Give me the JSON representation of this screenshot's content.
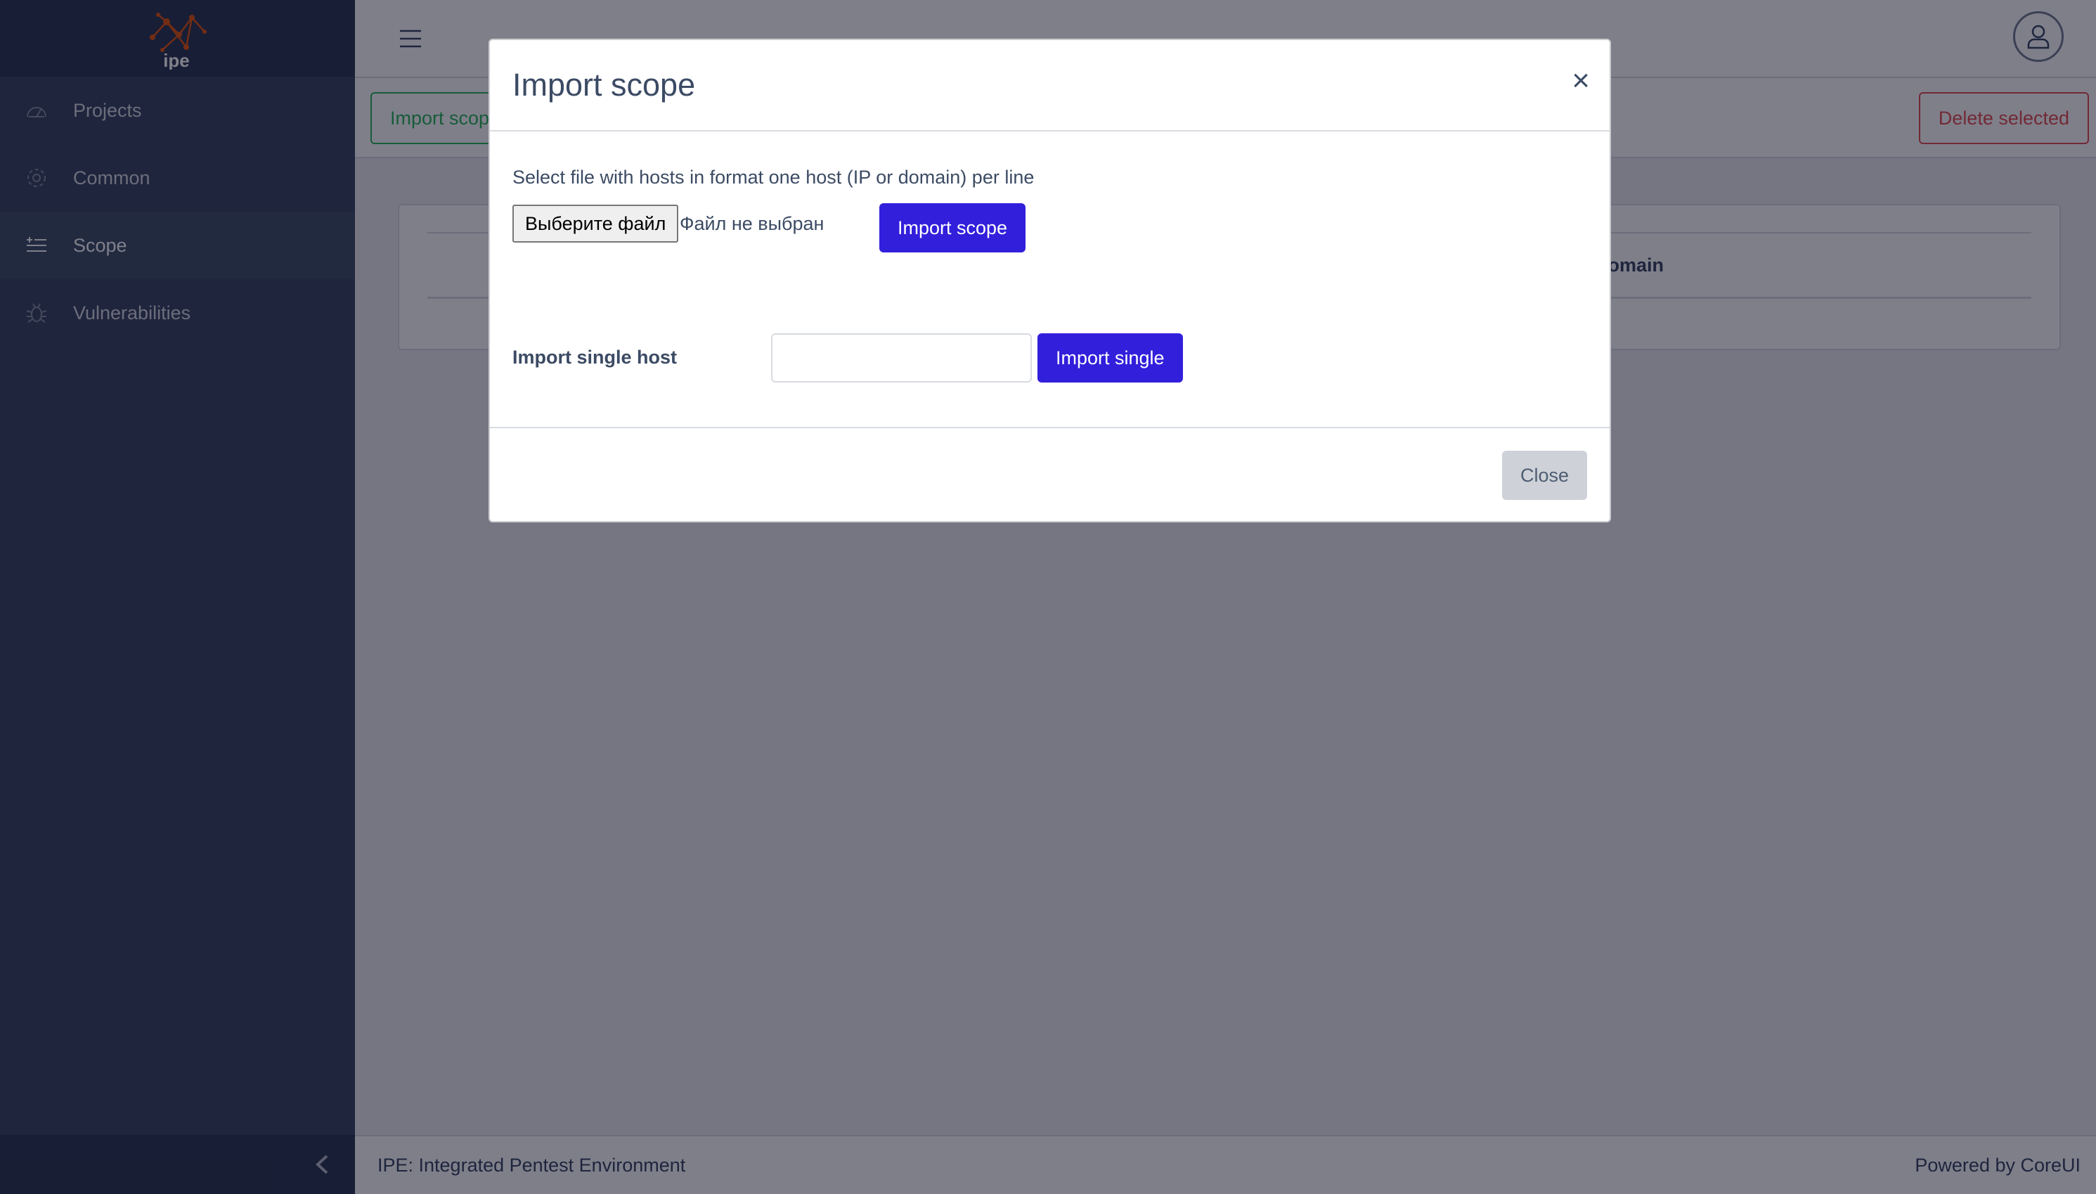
{
  "brand": {
    "logo_text": "ipe",
    "accent": "#e55b13"
  },
  "sidebar": {
    "items": [
      {
        "label": "Projects",
        "icon": "speedometer-icon"
      },
      {
        "label": "Common",
        "icon": "gear-icon"
      },
      {
        "label": "Scope",
        "icon": "list-add-icon"
      },
      {
        "label": "Vulnerabilities",
        "icon": "bug-icon"
      }
    ],
    "active": "Scope"
  },
  "toolbar": {
    "import_scope_label": "Import scope",
    "delete_selected_label": "Delete selected"
  },
  "table": {
    "visible_header": "Domain"
  },
  "modal": {
    "title": "Import scope",
    "close_glyph": "×",
    "instruction": "Select file with hosts in format one host (IP or domain) per line",
    "file_button_label": "Выберите файл",
    "file_status": "Файл не выбран",
    "import_scope_button": "Import scope",
    "single_label": "Import single host",
    "single_input_value": "",
    "import_single_button": "Import single",
    "close_button": "Close"
  },
  "footer": {
    "left": "IPE: Integrated Pentest Environment",
    "right": "Powered by CoreUI"
  },
  "colors": {
    "sidebar": "#3c4b64",
    "primary": "#321fdb",
    "success": "#2eb85c",
    "danger": "#e55353"
  }
}
